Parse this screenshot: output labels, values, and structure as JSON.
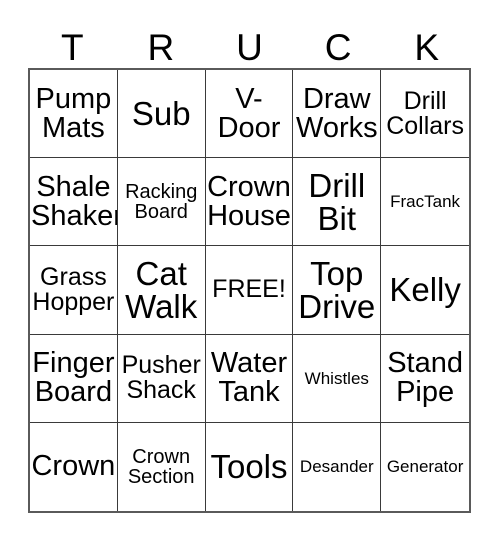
{
  "card": {
    "header_letters": [
      "T",
      "R",
      "U",
      "C",
      "K"
    ],
    "rows": [
      [
        {
          "text": "Pump\nMats",
          "size": "lg"
        },
        {
          "text": "Sub",
          "size": "xl"
        },
        {
          "text": "V-\nDoor",
          "size": "lg"
        },
        {
          "text": "Draw\nWorks",
          "size": "lg"
        },
        {
          "text": "Drill\nCollars",
          "size": "md"
        }
      ],
      [
        {
          "text": "Shale\nShaker",
          "size": "lg"
        },
        {
          "text": "Racking\nBoard",
          "size": "sm"
        },
        {
          "text": "Crown\nHouse",
          "size": "lg"
        },
        {
          "text": "Drill\nBit",
          "size": "xl"
        },
        {
          "text": "FracTank",
          "size": "xs"
        }
      ],
      [
        {
          "text": "Grass\nHopper",
          "size": "md"
        },
        {
          "text": "Cat\nWalk",
          "size": "xl"
        },
        {
          "text": "FREE!",
          "size": "md"
        },
        {
          "text": "Top\nDrive",
          "size": "xl"
        },
        {
          "text": "Kelly",
          "size": "xl"
        }
      ],
      [
        {
          "text": "Finger\nBoard",
          "size": "lg"
        },
        {
          "text": "Pusher\nShack",
          "size": "md"
        },
        {
          "text": "Water\nTank",
          "size": "lg"
        },
        {
          "text": "Whistles",
          "size": "xs"
        },
        {
          "text": "Stand\nPipe",
          "size": "lg"
        }
      ],
      [
        {
          "text": "Crown",
          "size": "lg"
        },
        {
          "text": "Crown\nSection",
          "size": "sm"
        },
        {
          "text": "Tools",
          "size": "xl"
        },
        {
          "text": "Desander",
          "size": "xs"
        },
        {
          "text": "Generator",
          "size": "xs"
        }
      ]
    ]
  }
}
